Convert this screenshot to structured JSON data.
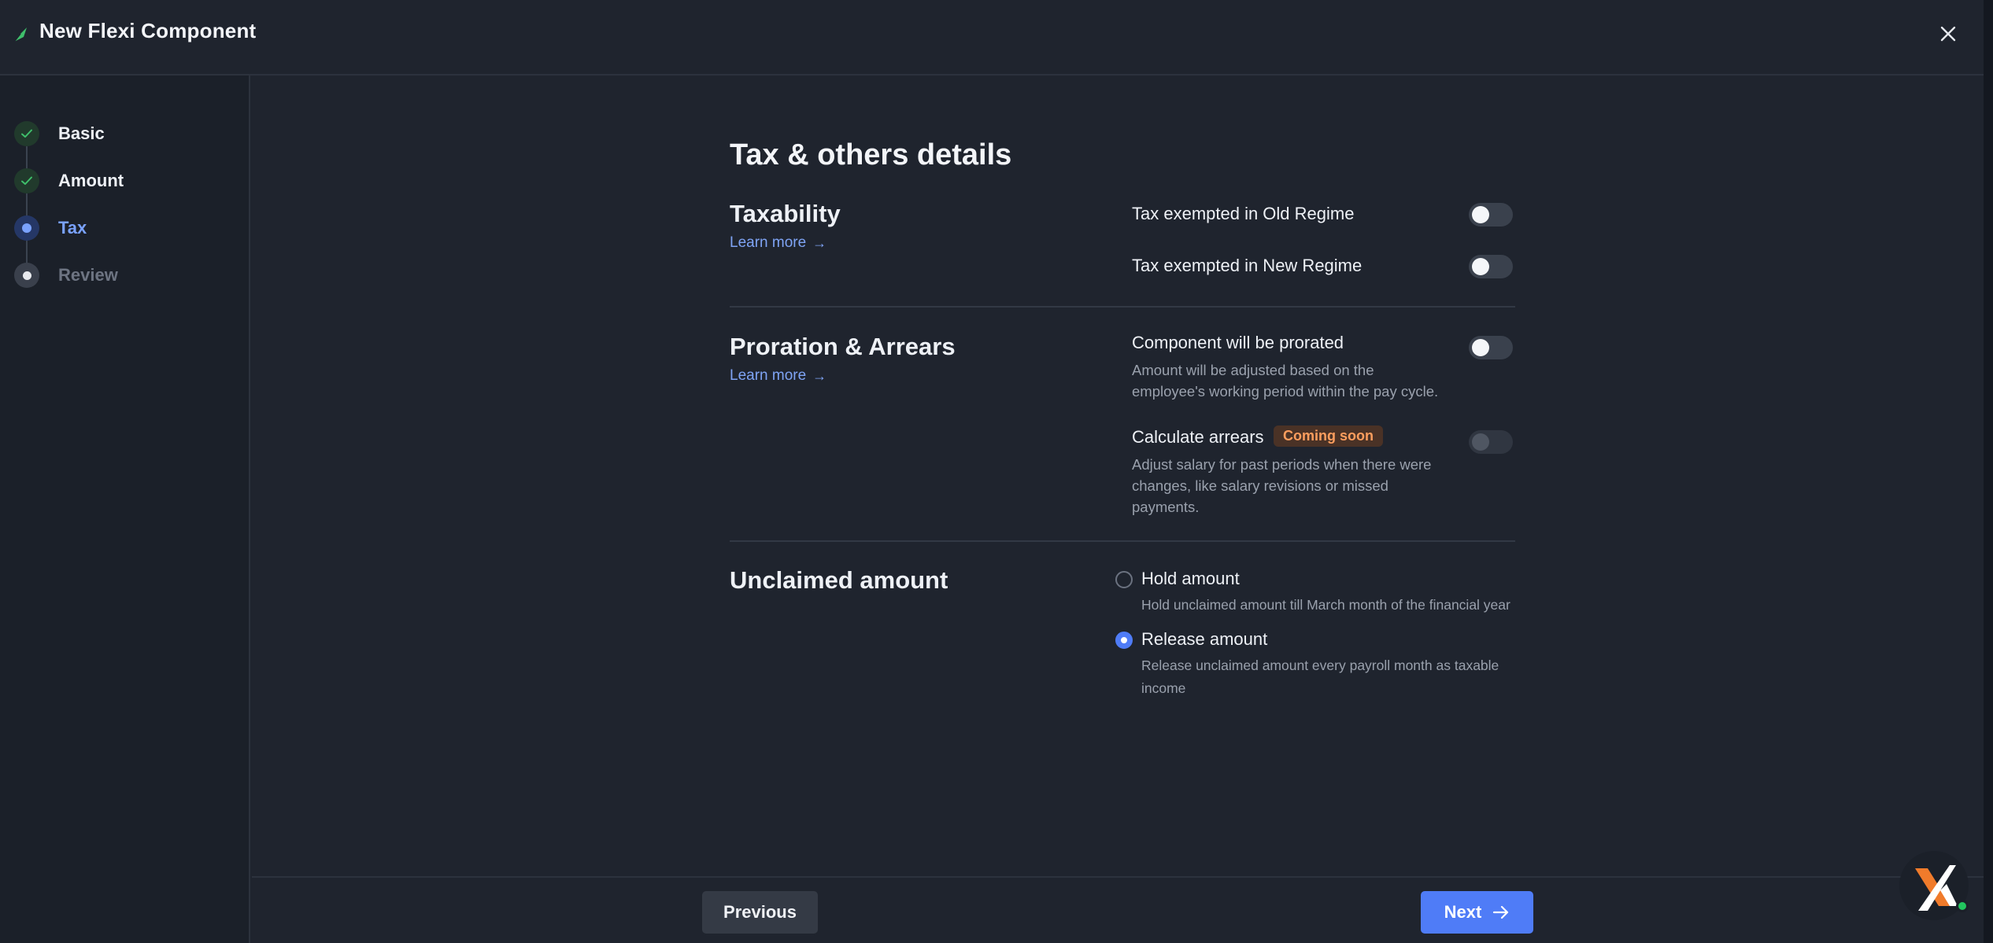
{
  "header": {
    "title": "New Flexi Component",
    "brand_icon": "leaf-icon",
    "close_icon": "close-icon"
  },
  "steps": [
    {
      "label": "Basic",
      "state": "done"
    },
    {
      "label": "Amount",
      "state": "done"
    },
    {
      "label": "Tax",
      "state": "active"
    },
    {
      "label": "Review",
      "state": "pending"
    }
  ],
  "main": {
    "heading": "Tax & others details",
    "taxability": {
      "title": "Taxability",
      "learn_more": "Learn more",
      "options": [
        {
          "label": "Tax exempted in Old Regime",
          "enabled": false
        },
        {
          "label": "Tax exempted in New Regime",
          "enabled": false
        }
      ]
    },
    "proration": {
      "title": "Proration & Arrears",
      "learn_more": "Learn more",
      "prorated": {
        "label": "Component will be prorated",
        "desc_line1": "Amount will be adjusted based on the",
        "desc_line2": "employee's working period within the pay cycle.",
        "enabled": false
      },
      "arrears": {
        "label": "Calculate arrears",
        "badge": "Coming soon",
        "desc_line1": "Adjust salary for past periods when there were",
        "desc_line2": "changes, like salary revisions or missed",
        "desc_line3": "payments.",
        "enabled": false,
        "disabled": true
      }
    },
    "unclaimed": {
      "title": "Unclaimed amount",
      "hold": {
        "label": "Hold amount",
        "desc": "Hold unclaimed amount till March month of the financial year",
        "selected": false
      },
      "release": {
        "label": "Release amount",
        "desc_line1": "Release unclaimed amount every payroll month as taxable",
        "desc_line2": "income",
        "selected": true
      }
    }
  },
  "footer": {
    "previous_label": "Previous",
    "next_label": "Next"
  },
  "colors": {
    "accent": "#4f7cf7",
    "link": "#7fa4f5",
    "badge_text": "#ff9e5e",
    "success": "#22c55e"
  }
}
